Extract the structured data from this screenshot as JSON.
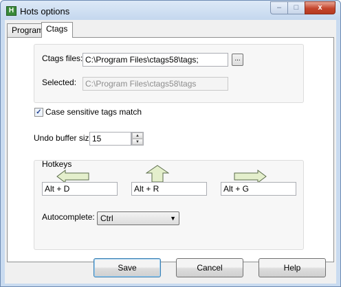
{
  "window": {
    "title": "Hots options",
    "app_icon_glyph": "H",
    "controls": {
      "minimize": "–",
      "maximize": "□",
      "close": "x"
    }
  },
  "tabs": [
    {
      "label": "Program",
      "active": false
    },
    {
      "label": "Ctags",
      "active": true
    }
  ],
  "ctags": {
    "files_label": "Ctags files:",
    "files_value": "C:\\Program Files\\ctags58\\tags;",
    "browse_label": "...",
    "selected_label": "Selected:",
    "selected_value": "C:\\Program Files\\ctags58\\tags"
  },
  "case_sensitive": {
    "label": "Case sensitive tags match",
    "checked": true,
    "check_glyph": "✓"
  },
  "undo": {
    "label": "Undo buffer size:",
    "value": "15",
    "up_glyph": "▲",
    "down_glyph": "▼"
  },
  "hotkeys": {
    "group_label": "Hotkeys",
    "items": [
      {
        "direction": "left",
        "icon": "arrow-left-icon",
        "value": "Alt + D"
      },
      {
        "direction": "up",
        "icon": "arrow-up-icon",
        "value": "Alt + R"
      },
      {
        "direction": "right",
        "icon": "arrow-right-icon",
        "value": "Alt + G"
      }
    ],
    "autocomplete_label": "Autocomplete:",
    "autocomplete_value": "Ctrl",
    "dropdown_glyph": "▼"
  },
  "buttons": {
    "save": "Save",
    "cancel": "Cancel",
    "help": "Help"
  },
  "colors": {
    "arrow_fill": "#e4efcc",
    "arrow_stroke": "#5a6b4a",
    "title_bar": "#c9dbf0"
  }
}
